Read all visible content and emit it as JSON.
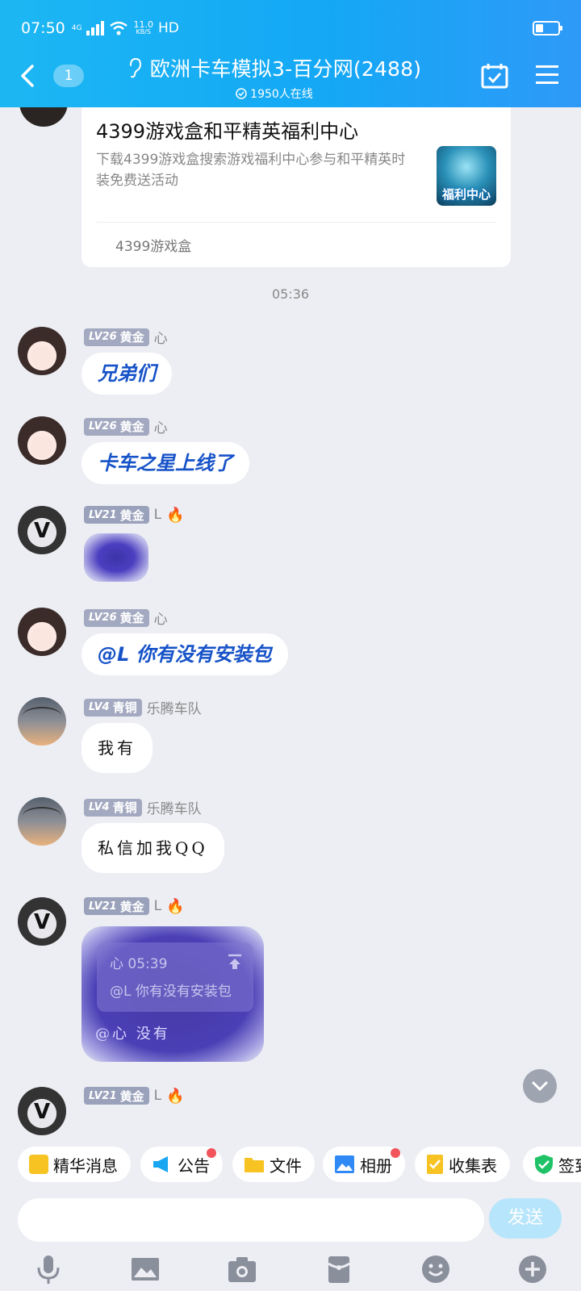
{
  "status_bar": {
    "time": "07:50",
    "network": "4G",
    "speed_value": "11.0",
    "speed_unit": "KB/S",
    "hd": "HD"
  },
  "header": {
    "unread_count": "1",
    "title": "欧洲卡车模拟3-百分网(2488)",
    "online_text": "1950人在线"
  },
  "share_card": {
    "title": "4399游戏盒和平精英福利中心",
    "description": "下载4399游戏盒搜索游戏福利中心参与和平精英时装免费送活动",
    "thumb_text": "福利中心",
    "source": "4399游戏盒"
  },
  "timestamp": "05:36",
  "messages": [
    {
      "level": "LV26",
      "rank": "黄金",
      "name": "心",
      "text": "兄弟们"
    },
    {
      "level": "LV26",
      "rank": "黄金",
      "name": "心",
      "text": "卡车之星上线了"
    },
    {
      "level": "LV21",
      "rank": "黄金",
      "name": "L",
      "text": ""
    },
    {
      "level": "LV26",
      "rank": "黄金",
      "name": "心",
      "text": "@L 你有没有安装包"
    },
    {
      "level": "LV4",
      "rank": "青铜",
      "name": "乐腾车队",
      "text": "我有"
    },
    {
      "level": "LV4",
      "rank": "青铜",
      "name": "乐腾车队",
      "text": "私信加我QQ"
    },
    {
      "level": "LV21",
      "rank": "黄金",
      "name": "L",
      "quote_header": "心 05:39",
      "quote_text": "@L 你有没有安装包",
      "text": "@心  没有"
    },
    {
      "level": "LV21",
      "rank": "黄金",
      "name": "L",
      "text": ""
    }
  ],
  "quick_tags": [
    "精华消息",
    "公告",
    "文件",
    "相册",
    "收集表",
    "签到"
  ],
  "input": {
    "placeholder": "",
    "send_label": "发送"
  },
  "colors": {
    "header_blue": "#14a8f5",
    "mention_blue": "#1652c8",
    "badge": "#a3a9c0",
    "red_dot": "#f2545b"
  }
}
